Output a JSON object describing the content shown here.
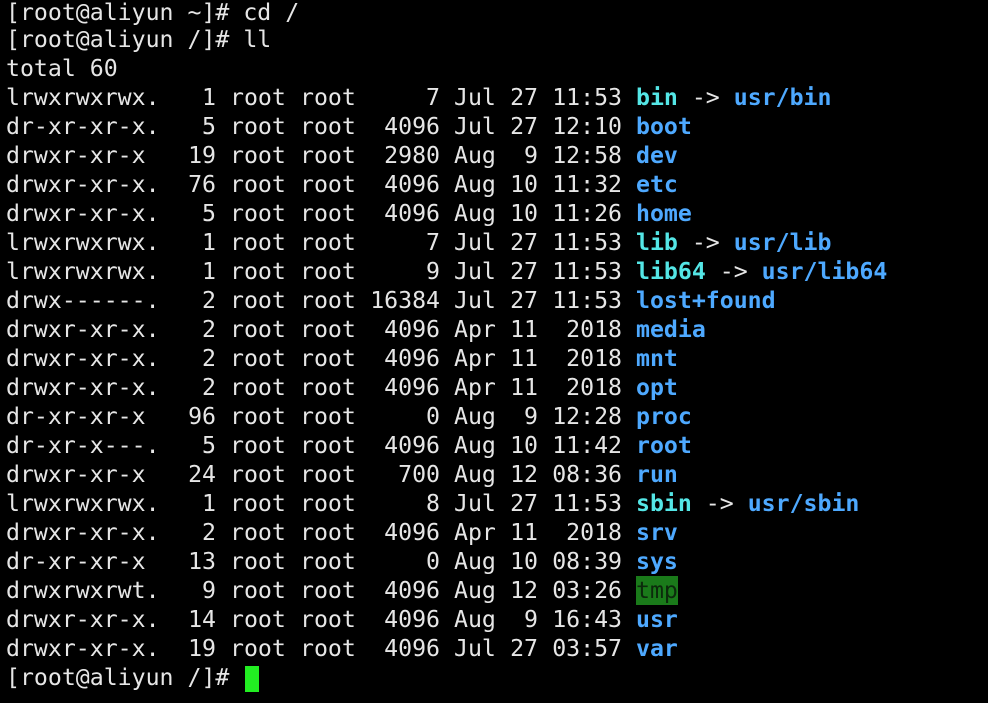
{
  "terminal": {
    "lines": {
      "prompt1": "[root@aliyun ~]# cd /",
      "prompt2": "[root@aliyun /]# ll",
      "total": "total 60",
      "prompt_final": "[root@aliyun /]# "
    },
    "entries": [
      {
        "perm": "lrwxrwxrwx.",
        "links": "1",
        "owner": "root",
        "group": "root",
        "size": "7",
        "month": "Jul",
        "day": "27",
        "time": "11:53",
        "name": "bin",
        "arrow": " -> ",
        "target": "usr/bin"
      },
      {
        "perm": "dr-xr-xr-x.",
        "links": "5",
        "owner": "root",
        "group": "root",
        "size": "4096",
        "month": "Jul",
        "day": "27",
        "time": "12:10",
        "name": "boot"
      },
      {
        "perm": "drwxr-xr-x",
        "links": "19",
        "owner": "root",
        "group": "root",
        "size": "2980",
        "month": "Aug",
        "day": "9",
        "time": "12:58",
        "name": "dev"
      },
      {
        "perm": "drwxr-xr-x.",
        "links": "76",
        "owner": "root",
        "group": "root",
        "size": "4096",
        "month": "Aug",
        "day": "10",
        "time": "11:32",
        "name": "etc"
      },
      {
        "perm": "drwxr-xr-x.",
        "links": "5",
        "owner": "root",
        "group": "root",
        "size": "4096",
        "month": "Aug",
        "day": "10",
        "time": "11:26",
        "name": "home"
      },
      {
        "perm": "lrwxrwxrwx.",
        "links": "1",
        "owner": "root",
        "group": "root",
        "size": "7",
        "month": "Jul",
        "day": "27",
        "time": "11:53",
        "name": "lib",
        "arrow": " -> ",
        "target": "usr/lib"
      },
      {
        "perm": "lrwxrwxrwx.",
        "links": "1",
        "owner": "root",
        "group": "root",
        "size": "9",
        "month": "Jul",
        "day": "27",
        "time": "11:53",
        "name": "lib64",
        "arrow": " -> ",
        "target": "usr/lib64"
      },
      {
        "perm": "drwx------.",
        "links": "2",
        "owner": "root",
        "group": "root",
        "size": "16384",
        "month": "Jul",
        "day": "27",
        "time": "11:53",
        "name": "lost+found"
      },
      {
        "perm": "drwxr-xr-x.",
        "links": "2",
        "owner": "root",
        "group": "root",
        "size": "4096",
        "month": "Apr",
        "day": "11",
        "time": "2018",
        "name": "media"
      },
      {
        "perm": "drwxr-xr-x.",
        "links": "2",
        "owner": "root",
        "group": "root",
        "size": "4096",
        "month": "Apr",
        "day": "11",
        "time": "2018",
        "name": "mnt"
      },
      {
        "perm": "drwxr-xr-x.",
        "links": "2",
        "owner": "root",
        "group": "root",
        "size": "4096",
        "month": "Apr",
        "day": "11",
        "time": "2018",
        "name": "opt"
      },
      {
        "perm": "dr-xr-xr-x",
        "links": "96",
        "owner": "root",
        "group": "root",
        "size": "0",
        "month": "Aug",
        "day": "9",
        "time": "12:28",
        "name": "proc"
      },
      {
        "perm": "dr-xr-x---.",
        "links": "5",
        "owner": "root",
        "group": "root",
        "size": "4096",
        "month": "Aug",
        "day": "10",
        "time": "11:42",
        "name": "root"
      },
      {
        "perm": "drwxr-xr-x",
        "links": "24",
        "owner": "root",
        "group": "root",
        "size": "700",
        "month": "Aug",
        "day": "12",
        "time": "08:36",
        "name": "run"
      },
      {
        "perm": "lrwxrwxrwx.",
        "links": "1",
        "owner": "root",
        "group": "root",
        "size": "8",
        "month": "Jul",
        "day": "27",
        "time": "11:53",
        "name": "sbin",
        "arrow": " -> ",
        "target": "usr/sbin"
      },
      {
        "perm": "drwxr-xr-x.",
        "links": "2",
        "owner": "root",
        "group": "root",
        "size": "4096",
        "month": "Apr",
        "day": "11",
        "time": "2018",
        "name": "srv"
      },
      {
        "perm": "dr-xr-xr-x",
        "links": "13",
        "owner": "root",
        "group": "root",
        "size": "0",
        "month": "Aug",
        "day": "10",
        "time": "08:39",
        "name": "sys"
      },
      {
        "perm": "drwxrwxrwt.",
        "links": "9",
        "owner": "root",
        "group": "root",
        "size": "4096",
        "month": "Aug",
        "day": "12",
        "time": "03:26",
        "name": "tmp"
      },
      {
        "perm": "drwxr-xr-x.",
        "links": "14",
        "owner": "root",
        "group": "root",
        "size": "4096",
        "month": "Aug",
        "day": "9",
        "time": "16:43",
        "name": "usr"
      },
      {
        "perm": "drwxr-xr-x.",
        "links": "19",
        "owner": "root",
        "group": "root",
        "size": "4096",
        "month": "Jul",
        "day": "27",
        "time": "03:57",
        "name": "var"
      }
    ],
    "colors": {
      "background": "#000000",
      "text": "#e6e6e6",
      "directory": "#4ea9ff",
      "symlink": "#54e6e6",
      "sticky_bg": "#1a7a1a",
      "cursor": "#22ee22"
    }
  }
}
